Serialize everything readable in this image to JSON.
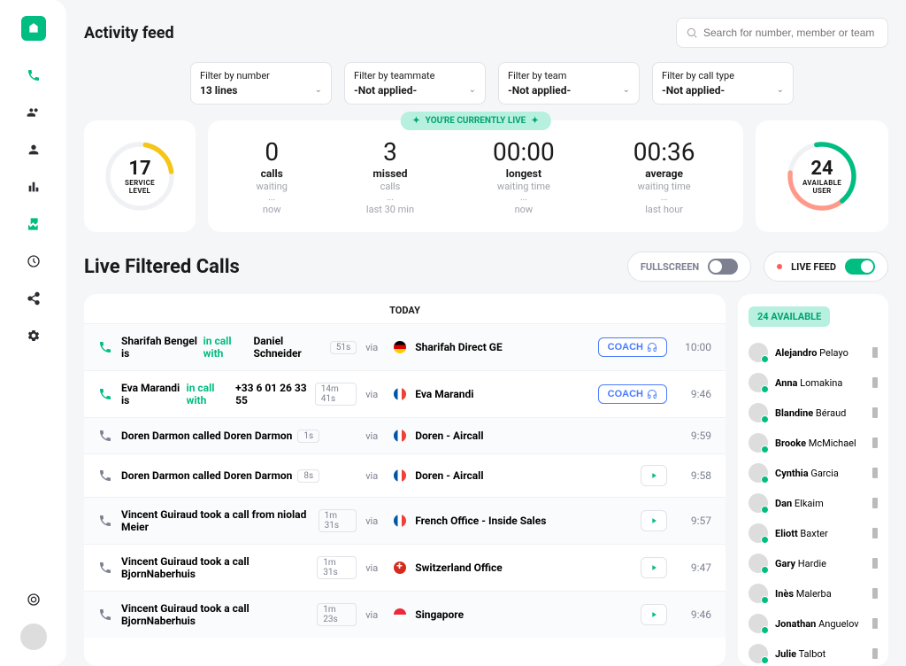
{
  "header": {
    "title": "Activity feed",
    "search_placeholder": "Search for number, member or team"
  },
  "filters": [
    {
      "label": "Filter by number",
      "value": "13 lines"
    },
    {
      "label": "Filter by teammate",
      "value": "-Not applied-"
    },
    {
      "label": "Filter by team",
      "value": "-Not applied-"
    },
    {
      "label": "Filter by call type",
      "value": "-Not applied-"
    }
  ],
  "live_badge": "YOU'RE CURRENTLY LIVE",
  "service_level": {
    "value": "17",
    "label1": "SERVICE",
    "label2": "LEVEL"
  },
  "metrics": [
    {
      "num": "0",
      "label": "calls",
      "sub": "waiting",
      "dots": "...",
      "time": "now"
    },
    {
      "num": "3",
      "label": "missed",
      "sub": "calls",
      "dots": "...",
      "time": "last 30 min"
    },
    {
      "num": "00:00",
      "label": "longest",
      "sub": "waiting time",
      "dots": "...",
      "time": "now"
    },
    {
      "num": "00:36",
      "label": "average",
      "sub": "waiting time",
      "dots": "...",
      "time": "last hour"
    }
  ],
  "available_user": {
    "value": "24",
    "label1": "AVAILABLE",
    "label2": "USER"
  },
  "section": {
    "title": "Live Filtered Calls",
    "fullscreen_label": "FULLSCREEN",
    "livefeed_label": "LIVE FEED"
  },
  "today_label": "TODAY",
  "coach_label": "COACH",
  "via_label": "via",
  "calls": [
    {
      "active": true,
      "desc_pre": "Sharifah Bengel is ",
      "status": "in call with",
      "desc_post": " Daniel Schneider",
      "duration": "51s",
      "flag": "de",
      "line": "Sharifah Direct GE",
      "action": "coach",
      "time": "10:00"
    },
    {
      "active": true,
      "desc_pre": "Eva Marandi is ",
      "status": "in call with",
      "desc_post": " +33 6 01 26 33 55",
      "duration": "14m 41s",
      "flag": "fr",
      "line": "Eva Marandi",
      "action": "coach",
      "time": "9:46"
    },
    {
      "active": false,
      "desc_pre": "Doren Darmon called  Doren Darmon",
      "status": "",
      "desc_post": "",
      "duration": "1s",
      "flag": "fr",
      "line": "Doren - Aircall",
      "action": "",
      "time": "9:59"
    },
    {
      "active": false,
      "desc_pre": "Doren Darmon called  Doren Darmon",
      "status": "",
      "desc_post": "",
      "duration": "8s",
      "flag": "fr",
      "line": "Doren - Aircall",
      "action": "play",
      "time": "9:58"
    },
    {
      "active": false,
      "desc_pre": "Vincent Guiraud took a call from niolad Meier",
      "status": "",
      "desc_post": "",
      "duration": "1m 31s",
      "flag": "fr",
      "line": "French Office - Inside Sales",
      "action": "play",
      "time": "9:57"
    },
    {
      "active": false,
      "desc_pre": "Vincent Guiraud took a call BjornNaberhuis",
      "status": "",
      "desc_post": "",
      "duration": "1m 31s",
      "flag": "ch",
      "line": "Switzerland Office",
      "action": "play",
      "time": "9:47"
    },
    {
      "active": false,
      "desc_pre": "Vincent Guiraud took a call BjornNaberhuis",
      "status": "",
      "desc_post": "",
      "duration": "1m 23s",
      "flag": "sg",
      "line": "Singapore",
      "action": "play",
      "time": "9:46"
    }
  ],
  "available": {
    "count_label": "24 AVAILABLE",
    "users": [
      {
        "first": "Alejandro",
        "last": "Pelayo"
      },
      {
        "first": "Anna",
        "last": "Lomakina"
      },
      {
        "first": "Blandine",
        "last": "Béraud"
      },
      {
        "first": "Brooke",
        "last": "McMichael"
      },
      {
        "first": "Cynthia",
        "last": "Garcia"
      },
      {
        "first": "Dan",
        "last": "Elkaim"
      },
      {
        "first": "Eliott",
        "last": "Baxter"
      },
      {
        "first": "Gary",
        "last": "Hardie"
      },
      {
        "first": "Inès",
        "last": "Malerba"
      },
      {
        "first": "Jonathan",
        "last": "Anguelov"
      },
      {
        "first": "Julie",
        "last": "Talbot"
      }
    ]
  }
}
